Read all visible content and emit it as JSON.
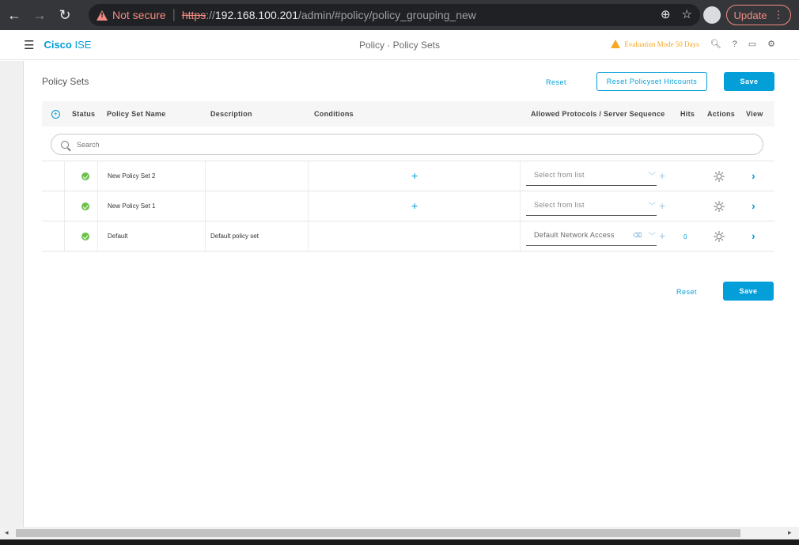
{
  "browser": {
    "not_secure": "Not secure",
    "url_scheme": "https",
    "url_sep": "://",
    "url_host": "192.168.100.201",
    "url_path": "/admin/#policy/policy_grouping_new",
    "update_label": "Update"
  },
  "app": {
    "brand_bold": "Cisco",
    "brand_rest": " ISE",
    "header_title": "Policy · Policy Sets",
    "eval_text": "Evaluation Mode 50 Days"
  },
  "policy": {
    "title": "Policy Sets",
    "reset_label": "Reset",
    "reset_hitcounts_label": "Reset Policyset Hitcounts",
    "save_label": "Save",
    "bottom_reset_label": "Reset",
    "bottom_save_label": "Save"
  },
  "table": {
    "columns": [
      "Status",
      "Policy Set Name",
      "Description",
      "Conditions",
      "Allowed Protocols / Server Sequence",
      "Hits",
      "Actions",
      "View"
    ],
    "search_placeholder": "Search",
    "rows": [
      {
        "name": "New Policy Set 2",
        "description": "",
        "protocol": "Select from list",
        "hits": ""
      },
      {
        "name": "New Policy Set 1",
        "description": "",
        "protocol": "Select from list",
        "hits": ""
      },
      {
        "name": "Default",
        "description": "Default policy set",
        "protocol": "Default Network Access",
        "hits": "0"
      }
    ]
  },
  "colors": {
    "accent": "#049fd9",
    "status_ok": "#6cc04a",
    "warning": "#f5a623"
  }
}
